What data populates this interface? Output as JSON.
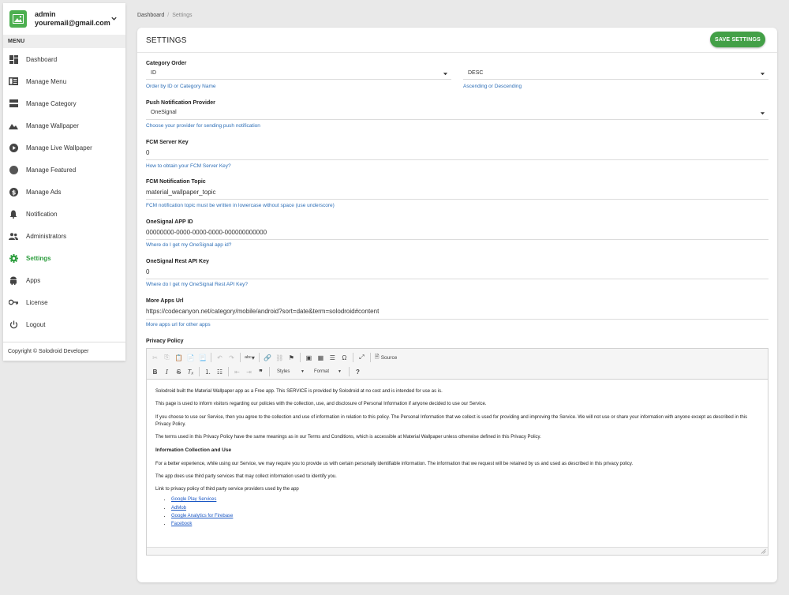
{
  "user": {
    "name": "admin",
    "email": "youremail@gmail.com"
  },
  "sidebar": {
    "menu_header": "MENU",
    "items": [
      {
        "label": "Dashboard",
        "icon": "dashboard-icon"
      },
      {
        "label": "Manage Menu",
        "icon": "menu-icon"
      },
      {
        "label": "Manage Category",
        "icon": "category-icon"
      },
      {
        "label": "Manage Wallpaper",
        "icon": "wallpaper-icon"
      },
      {
        "label": "Manage Live Wallpaper",
        "icon": "play-icon"
      },
      {
        "label": "Manage Featured",
        "icon": "featured-icon"
      },
      {
        "label": "Manage Ads",
        "icon": "dollar-icon"
      },
      {
        "label": "Notification",
        "icon": "bell-icon"
      },
      {
        "label": "Administrators",
        "icon": "people-icon"
      },
      {
        "label": "Settings",
        "icon": "gear-icon",
        "active": true
      },
      {
        "label": "Apps",
        "icon": "android-icon"
      },
      {
        "label": "License",
        "icon": "key-icon"
      },
      {
        "label": "Logout",
        "icon": "power-icon"
      }
    ],
    "footer": "Copyright © Solodroid Developer"
  },
  "breadcrumb": {
    "home": "Dashboard",
    "current": "Settings"
  },
  "card": {
    "title": "SETTINGS",
    "save_label": "SAVE SETTINGS"
  },
  "form": {
    "category_order": {
      "label": "Category Order",
      "value": "ID",
      "hint": "Order by ID or Category Name",
      "direction_value": "DESC",
      "direction_hint": "Ascending or Descending"
    },
    "push_provider": {
      "label": "Push Notification Provider",
      "value": "OneSignal",
      "hint": "Choose your provider for sending push notification"
    },
    "fcm_key": {
      "label": "FCM Server Key",
      "value": "0",
      "hint": "How to obtain your FCM Server Key?"
    },
    "fcm_topic": {
      "label": "FCM Notification Topic",
      "value": "material_wallpaper_topic",
      "hint": "FCM notification topic must be written in lowercase without space (use underscore)"
    },
    "onesignal_app_id": {
      "label": "OneSignal APP ID",
      "value": "00000000-0000-0000-0000-000000000000",
      "hint": "Where do I get my OneSignal app id?"
    },
    "onesignal_rest_key": {
      "label": "OneSignal Rest API Key",
      "value": "0",
      "hint": "Where do I get my OneSignal Rest API Key?"
    },
    "more_apps": {
      "label": "More Apps Url",
      "value": "https://codecanyon.net/category/mobile/android?sort=date&term=solodroid#content",
      "hint": "More apps url for other apps"
    },
    "privacy": {
      "label": "Privacy Policy"
    }
  },
  "editor": {
    "styles_label": "Styles",
    "format_label": "Format",
    "source_label": "Source",
    "p1": "Solodroid built the Material Wallpaper app as a Free app. This SERVICE is provided by Solodroid at no cost and is intended for use as is.",
    "p2": "This page is used to inform visitors regarding our policies with the collection, use, and disclosure of Personal Information if anyone decided to use our Service.",
    "p3": "If you choose to use our Service, then you agree to the collection and use of information in relation to this policy. The Personal Information that we collect is used for providing and improving the Service. We will not use or share your information with anyone except as described in this Privacy Policy.",
    "p4": "The terms used in this Privacy Policy have the same meanings as in our Terms and Conditions, which is accessible at Material Wallpaper unless otherwise defined in this Privacy Policy.",
    "h1": "Information Collection and Use",
    "p5": "For a better experience, while using our Service, we may require you to provide us with certain personally identifiable information. The information that we request will be retained by us and used as described in this privacy policy.",
    "p6": "The app does use third party services that may collect information used to identify you.",
    "p7": "Link to privacy policy of third party service providers used by the app",
    "links": [
      "Google Play Services",
      "AdMob",
      "Google Analytics for Firebase",
      "Facebook"
    ]
  },
  "colors": {
    "accent": "#43a047",
    "active_text": "#2e9e3f",
    "link": "#2e6fb7"
  }
}
